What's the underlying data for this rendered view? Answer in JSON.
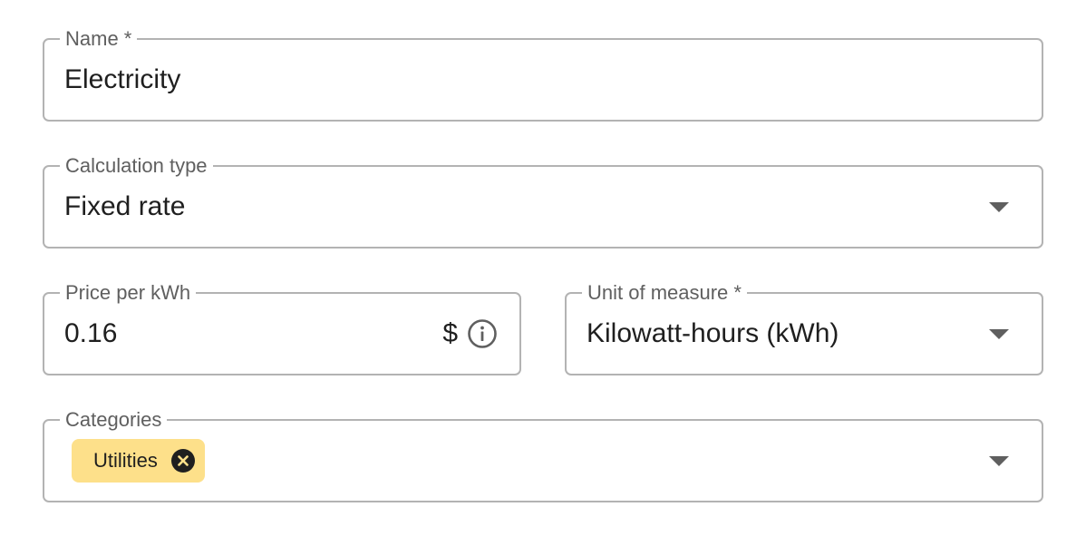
{
  "form": {
    "name": {
      "label": "Name *",
      "value": "Electricity"
    },
    "calculation_type": {
      "label": "Calculation type",
      "value": "Fixed rate",
      "icon": "chevron-down-icon"
    },
    "price": {
      "label": "Price per kWh",
      "value": "0.16",
      "currency_symbol": "$",
      "icon": "info-icon"
    },
    "unit": {
      "label": "Unit of measure *",
      "value": "Kilowatt-hours (kWh)",
      "icon": "chevron-down-icon"
    },
    "categories": {
      "label": "Categories",
      "chips": [
        {
          "label": "Utilities",
          "icon": "close-circle-icon"
        }
      ],
      "icon": "chevron-down-icon"
    }
  },
  "colors": {
    "border": "#b3b3b3",
    "label": "#5f5f5f",
    "text": "#1f1f1f",
    "chip_background": "#fde08a",
    "chip_remove_icon": "#1f1f1f"
  }
}
